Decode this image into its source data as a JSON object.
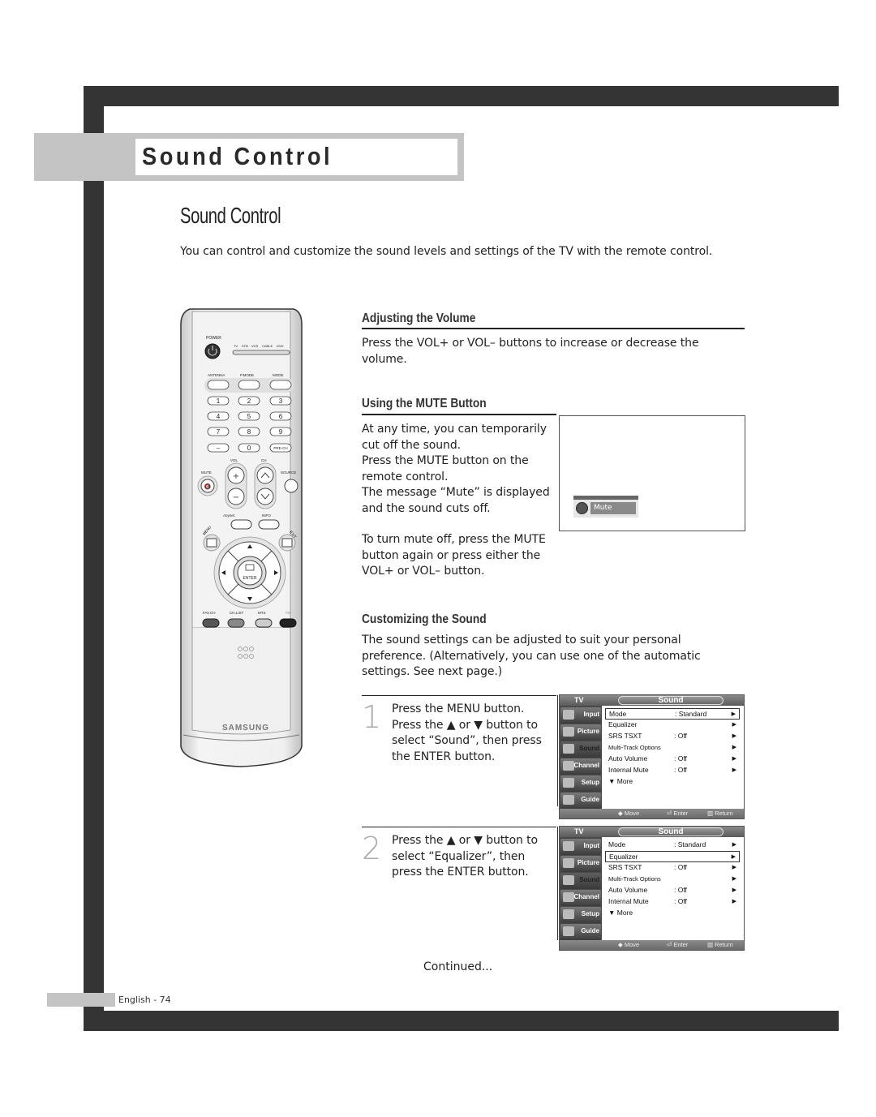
{
  "page": {
    "tab_title": "Sound Control",
    "heading": "Sound Control",
    "intro": "You can control and customize the sound levels and settings of the TV with the remote control.",
    "continued": "Continued...",
    "page_number": "English - 74"
  },
  "remote": {
    "brand": "SAMSUNG",
    "power_label": "POWER",
    "mode_indicators": [
      "TV",
      "STB",
      "VCR",
      "CABLE",
      "DVD"
    ],
    "top_buttons": [
      "ANTENNA",
      "P.MODE",
      "MODE"
    ],
    "number_keys": [
      "1",
      "2",
      "3",
      "4",
      "5",
      "6",
      "7",
      "8",
      "9",
      "–",
      "0",
      "PRE-CH"
    ],
    "vol_label": "VOL",
    "ch_label": "CH",
    "mute_label": "MUTE",
    "source_label": "SOURCE",
    "anynet_label": "Anynet",
    "info_label": "INFO",
    "menu_label": "MENU",
    "exit_label": "EXIT",
    "enter_label": "ENTER",
    "bottom_buttons": [
      "FAV.CH",
      "CH.LIST",
      "MTS",
      "PIP"
    ]
  },
  "sections": {
    "volume": {
      "title": "Adjusting the Volume",
      "text": "Press the VOL+ or VOL– buttons to increase or decrease the volume."
    },
    "mute": {
      "title": "Using the MUTE Button",
      "lines": [
        "At any time, you can temporarily",
        "cut off the sound.",
        "Press the MUTE button on the",
        "remote control.",
        "The message “Mute” is displayed",
        "and the sound cuts off."
      ],
      "lines2": [
        "To turn mute off, press the MUTE",
        "button again or press either the",
        "VOL+ or VOL– button."
      ],
      "osd_label": "Mute"
    },
    "customize": {
      "title": "Customizing the Sound",
      "lines": [
        "The sound settings can be adjusted to suit your personal",
        "preference. (Alternatively, you can use one of the automatic",
        "settings. See next page.)"
      ]
    }
  },
  "steps": [
    {
      "number": "1",
      "lines": [
        "Press the MENU button.",
        "Press the ▲ or ▼ button to",
        "select “Sound”, then press",
        "the ENTER button."
      ]
    },
    {
      "number": "2",
      "lines": [
        "Press the ▲ or ▼ button to",
        "select “Equalizer”, then",
        "press the ENTER button."
      ]
    }
  ],
  "osd_menus": [
    {
      "tv_label": "TV",
      "title": "Sound",
      "sidebar": [
        "Input",
        "Picture",
        "Sound",
        "Channel",
        "Setup",
        "Guide"
      ],
      "active_sidebar": "Sound",
      "rows": [
        {
          "label": "Mode",
          "value": ": Standard",
          "arrow": "▶",
          "selected": true
        },
        {
          "label": "Equalizer",
          "value": "",
          "arrow": "▶",
          "selected": false
        },
        {
          "label": "SRS TSXT",
          "value": ": Off",
          "arrow": "▶",
          "selected": false
        },
        {
          "label": "Multi-Track Options",
          "value": "",
          "arrow": "▶",
          "selected": false
        },
        {
          "label": "Auto Volume",
          "value": ": Off",
          "arrow": "▶",
          "selected": false
        },
        {
          "label": "Internal Mute",
          "value": ": Off",
          "arrow": "▶",
          "selected": false
        },
        {
          "label": "▼ More",
          "value": "",
          "arrow": "",
          "selected": false
        }
      ],
      "footer": [
        "◆ Move",
        "⏎ Enter",
        "▥ Return"
      ]
    },
    {
      "tv_label": "TV",
      "title": "Sound",
      "sidebar": [
        "Input",
        "Picture",
        "Sound",
        "Channel",
        "Setup",
        "Guide"
      ],
      "active_sidebar": "Sound",
      "rows": [
        {
          "label": "Mode",
          "value": ": Standard",
          "arrow": "▶",
          "selected": false
        },
        {
          "label": "Equalizer",
          "value": "",
          "arrow": "▶",
          "selected": true
        },
        {
          "label": "SRS TSXT",
          "value": ": Off",
          "arrow": "▶",
          "selected": false
        },
        {
          "label": "Multi-Track Options",
          "value": "",
          "arrow": "▶",
          "selected": false
        },
        {
          "label": "Auto Volume",
          "value": ": Off",
          "arrow": "▶",
          "selected": false
        },
        {
          "label": "Internal Mute",
          "value": ": Off",
          "arrow": "▶",
          "selected": false
        },
        {
          "label": "▼ More",
          "value": "",
          "arrow": "",
          "selected": false
        }
      ],
      "footer": [
        "◆ Move",
        "⏎ Enter",
        "▥ Return"
      ]
    }
  ]
}
